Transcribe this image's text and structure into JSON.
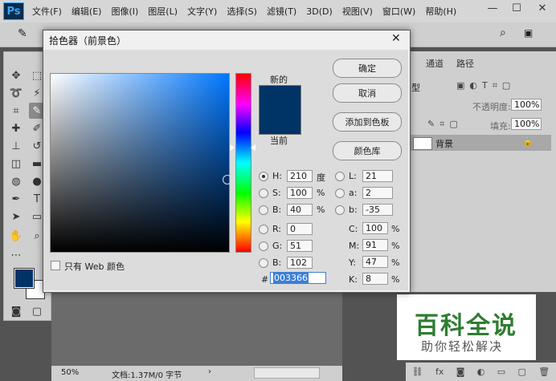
{
  "app": {
    "logo": "Ps"
  },
  "menu": [
    "文件(F)",
    "编辑(E)",
    "图像(I)",
    "图层(L)",
    "文字(Y)",
    "选择(S)",
    "滤镜(T)",
    "3D(D)",
    "视图(V)",
    "窗口(W)",
    "帮助(H)"
  ],
  "window_controls": {
    "minimize": "—",
    "restore": "☐",
    "close": "✕"
  },
  "dialog": {
    "title": "拾色器（前景色）",
    "close": "✕",
    "new_label": "新的",
    "current_label": "当前",
    "swatch_color": "#003366",
    "buttons": {
      "ok": "确定",
      "cancel": "取消",
      "add_swatch": "添加到色板",
      "libraries": "颜色库"
    },
    "hsb": [
      {
        "label": "H:",
        "value": "210",
        "unit": "度"
      },
      {
        "label": "S:",
        "value": "100",
        "unit": "%"
      },
      {
        "label": "B:",
        "value": "40",
        "unit": "%"
      }
    ],
    "rgb": [
      {
        "label": "R:",
        "value": "0"
      },
      {
        "label": "G:",
        "value": "51"
      },
      {
        "label": "B:",
        "value": "102"
      }
    ],
    "lab": [
      {
        "label": "L:",
        "value": "21"
      },
      {
        "label": "a:",
        "value": "2"
      },
      {
        "label": "b:",
        "value": "-35"
      }
    ],
    "cmyk": [
      {
        "label": "C:",
        "value": "100",
        "unit": "%"
      },
      {
        "label": "M:",
        "value": "91",
        "unit": "%"
      },
      {
        "label": "Y:",
        "value": "47",
        "unit": "%"
      },
      {
        "label": "K:",
        "value": "8",
        "unit": "%"
      }
    ],
    "hex_label": "#",
    "hex_value": "003366",
    "web_only_label": "只有 Web 颜色"
  },
  "layers_panel": {
    "tabs": [
      "通道",
      "路径"
    ],
    "filter_label": "型",
    "opacity_label": "不透明度:",
    "opacity_value": "100%",
    "fill_label": "填充:",
    "fill_value": "100%",
    "layer_name": "背景"
  },
  "status": {
    "zoom": "50%",
    "doc_info": "文档:1.37M/0 字节"
  },
  "foreground_color": "#003366",
  "watermark": {
    "main": "百科全说",
    "sub": "助你轻松解决"
  }
}
